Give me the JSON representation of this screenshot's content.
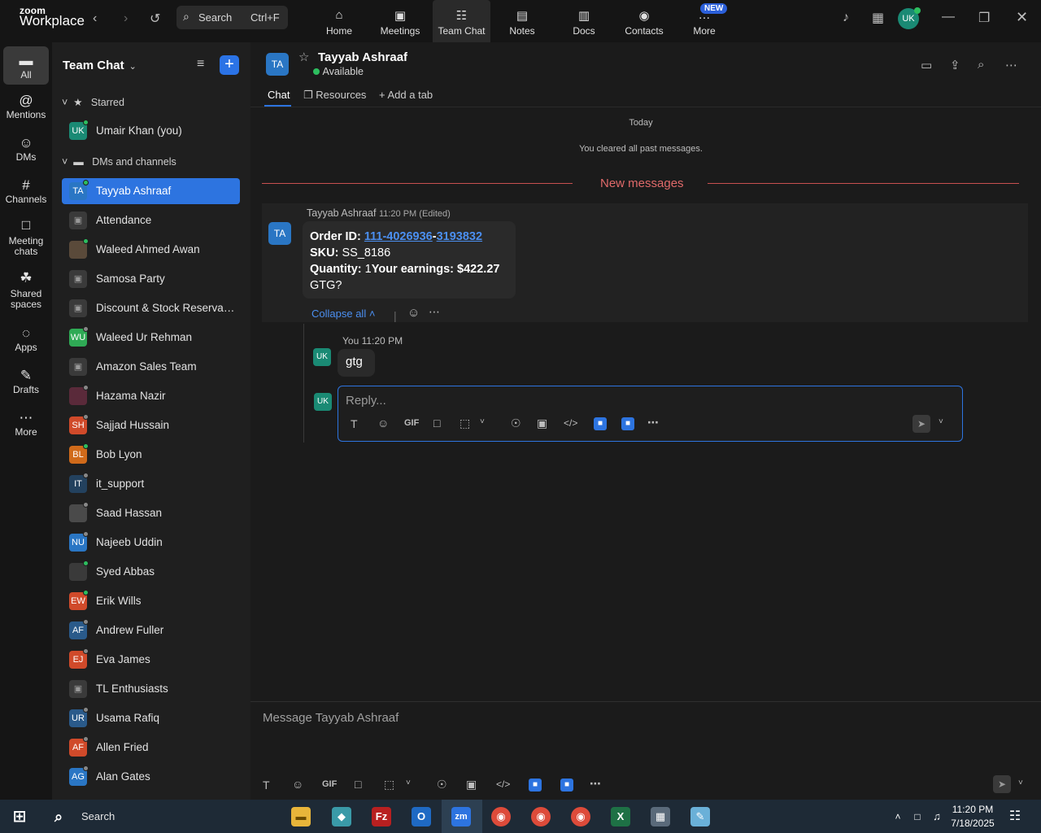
{
  "app": {
    "brand_top": "zoom",
    "brand_bottom": "Workplace"
  },
  "titlebar": {
    "search_placeholder": "Search",
    "search_shortcut": "Ctrl+F",
    "nav": [
      {
        "label": "Home",
        "icon": "home-icon"
      },
      {
        "label": "Meetings",
        "icon": "video-icon"
      },
      {
        "label": "Team Chat",
        "icon": "chat-icon",
        "active": true
      },
      {
        "label": "Notes",
        "icon": "notes-icon"
      },
      {
        "label": "Docs",
        "icon": "docs-icon"
      },
      {
        "label": "Contacts",
        "icon": "contacts-icon"
      },
      {
        "label": "More",
        "icon": "more-icon"
      }
    ],
    "new_badge": "NEW",
    "avatar": "UK"
  },
  "rail": [
    {
      "label": "All",
      "icon": "chat-bubble-icon",
      "active": true
    },
    {
      "label": "Mentions",
      "icon": "at-icon"
    },
    {
      "label": "DMs",
      "icon": "people-icon"
    },
    {
      "label": "Channels",
      "icon": "hash-icon"
    },
    {
      "label": "Meeting chats",
      "icon": "calendar-icon"
    },
    {
      "label": "Shared spaces",
      "icon": "shared-icon"
    },
    {
      "label": "Apps",
      "icon": "apps-icon"
    },
    {
      "label": "Drafts",
      "icon": "drafts-icon"
    },
    {
      "label": "More",
      "icon": "more-dots-icon"
    }
  ],
  "sidebar": {
    "title": "Team Chat",
    "starred_label": "Starred",
    "dms_label": "DMs and channels",
    "starred": [
      {
        "name": "Umair Khan (you)",
        "initials": "UK",
        "color": "#1a8a74",
        "status": "online"
      }
    ],
    "items": [
      {
        "name": "Tayyab Ashraaf",
        "initials": "TA",
        "color": "#2a76c4",
        "status": "online",
        "selected": true
      },
      {
        "name": "Attendance",
        "initials": "",
        "color": "#3a3a3a",
        "status": "",
        "locked": true
      },
      {
        "name": "Waleed Ahmed Awan",
        "initials": "",
        "color": "#5a4a3a",
        "status": "online"
      },
      {
        "name": "Samosa Party",
        "initials": "",
        "color": "#3a3a3a",
        "status": "",
        "locked": true
      },
      {
        "name": "Discount & Stock Reservati...",
        "initials": "",
        "color": "#3a3a3a",
        "status": "",
        "locked": true
      },
      {
        "name": "Waleed Ur Rehman",
        "initials": "WU",
        "color": "#2faa55",
        "status": "away"
      },
      {
        "name": "Amazon Sales Team",
        "initials": "",
        "color": "#3a3a3a",
        "status": "",
        "locked": true
      },
      {
        "name": "Hazama Nazir",
        "initials": "",
        "color": "#5a2a3a",
        "status": "away"
      },
      {
        "name": "Sajjad Hussain",
        "initials": "SH",
        "color": "#d04a2a",
        "status": "away"
      },
      {
        "name": "Bob Lyon",
        "initials": "BL",
        "color": "#d06a1a",
        "status": "online"
      },
      {
        "name": "it_support",
        "initials": "IT",
        "color": "#23415e",
        "status": "away"
      },
      {
        "name": "Saad Hassan",
        "initials": "",
        "color": "#4a4a4a",
        "status": "away"
      },
      {
        "name": "Najeeb Uddin",
        "initials": "NU",
        "color": "#2a76c4",
        "status": "away"
      },
      {
        "name": "Syed Abbas",
        "initials": "",
        "color": "#3a3a3a",
        "status": "online"
      },
      {
        "name": "Erik Wills",
        "initials": "EW",
        "color": "#d04a2a",
        "status": "online"
      },
      {
        "name": "Andrew Fuller",
        "initials": "AF",
        "color": "#2a5a8a",
        "status": "away"
      },
      {
        "name": "Eva James",
        "initials": "EJ",
        "color": "#d04a2a",
        "status": "away"
      },
      {
        "name": "TL Enthusiasts",
        "initials": "",
        "color": "#3a3a3a",
        "status": "",
        "locked": true
      },
      {
        "name": "Usama Rafiq",
        "initials": "UR",
        "color": "#2a5a8a",
        "status": "away"
      },
      {
        "name": "Allen Fried",
        "initials": "AF",
        "color": "#d04a2a",
        "status": "away"
      },
      {
        "name": "Alan Gates",
        "initials": "AG",
        "color": "#2a76c4",
        "status": "away"
      }
    ]
  },
  "conversation": {
    "contact_name": "Tayyab Ashraaf",
    "contact_initials": "TA",
    "status": "Available",
    "tabs": [
      "Chat",
      "Resources",
      "Add a tab"
    ],
    "date_label": "Today",
    "cleared_note": "You cleared all past messages.",
    "new_messages_label": "New messages",
    "message": {
      "author": "Tayyab Ashraaf",
      "time": "11:20 PM (Edited)",
      "order_label": "Order ID:",
      "order_part1": "111-4026936",
      "order_sep": "-",
      "order_part2": "3193832",
      "sku_label": "SKU:",
      "sku_value": "SS_8186",
      "qty_label": "Quantity:",
      "qty_value": "1",
      "earnings_label": "Your earnings:",
      "earnings_value": "$422.27",
      "last_line": "GTG?"
    },
    "collapse_label": "Collapse all",
    "reply": {
      "author": "You",
      "time": "11:20 PM",
      "text": "gtg",
      "initials": "UK"
    },
    "reply_placeholder": "Reply...",
    "compose_placeholder": "Message Tayyab Ashraaf"
  },
  "taskbar": {
    "search_label": "Search",
    "time": "11:20 PM",
    "date": "7/18/2025"
  }
}
